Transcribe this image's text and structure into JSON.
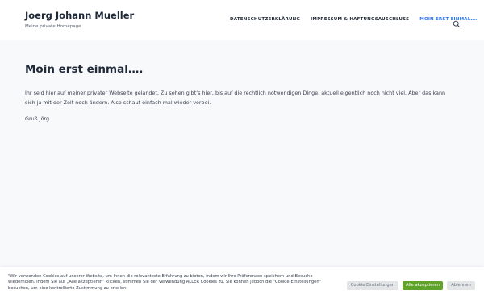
{
  "header": {
    "site_title": "Joerg Johann Mueller",
    "tagline": "Meine private Homepage",
    "nav": [
      {
        "label": "DATENSCHUTZERKLÄRUNG",
        "active": false
      },
      {
        "label": "IMPRESSUM & HAFTUNGSAUSCHLUSS",
        "active": false
      },
      {
        "label": "MOIN ERST EINMAL….",
        "active": true
      }
    ],
    "search_icon": "search-icon",
    "accent_color": "#2872fa"
  },
  "main": {
    "title": "Moin erst einmal….",
    "body": "Ihr seid hier auf meiner privater Webseite gelandet. Zu sehen gibt’s hier, bis auf die rechtlich notwendigen Dinge, aktuell eigentlich noch nicht viel. Aber das kann sich ja mit der Zeit noch ändern. Also schaut einfach mal wieder vorbei.",
    "signoff": "Gruß Jörg"
  },
  "cookie": {
    "text": "\"Wir verwenden Cookies auf unserer Website, um Ihnen die relevanteste Erfahrung zu bieten, indem wir Ihre Präferenzen speichern und Besuche wiederholen. Indem Sie auf „Alle akzeptieren“ klicken, stimmen Sie der Verwendung ALLER Cookies zu. Sie können jedoch die \"Cookie-Einstellungen\" besuchen, um eine kontrollierte Zustimmung zu erteilen.",
    "settings_label": "Cookie Einstellungen",
    "accept_label": "Alle akzeptieren",
    "reject_label": "Ablehnen",
    "accept_color": "#61a229"
  }
}
